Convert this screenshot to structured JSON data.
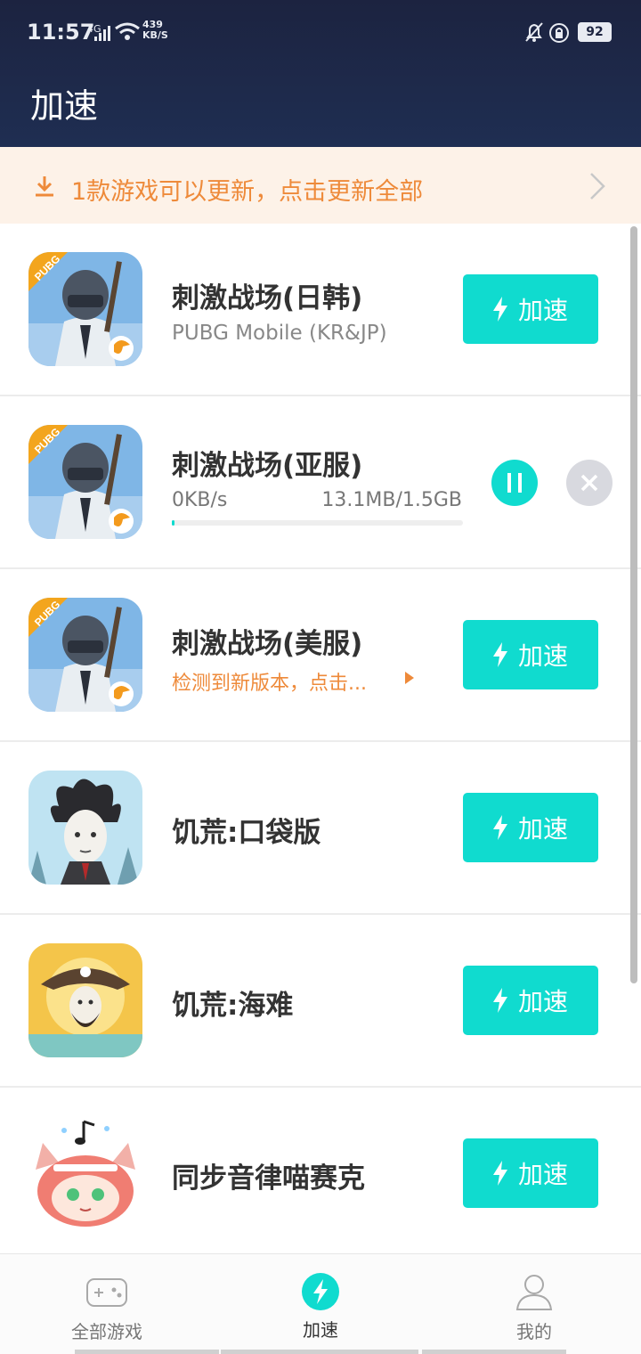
{
  "status_bar": {
    "time": "11:57",
    "network": "4G",
    "speed_value": "439",
    "speed_unit": "KB/S",
    "battery": "92"
  },
  "header": {
    "title": "加速"
  },
  "update_banner": {
    "text": "1款游戏可以更新，点击更新全部"
  },
  "games": [
    {
      "title": "刺激战场(日韩)",
      "subtitle": "PUBG Mobile (KR&JP)",
      "action_label": "加速",
      "icon": "pubg-icon"
    },
    {
      "title": "刺激战场(亚服)",
      "download_speed": "0KB/s",
      "download_size": "13.1MB/1.5GB",
      "progress": 0.0087,
      "icon": "pubg-icon"
    },
    {
      "title": "刺激战场(美服)",
      "update_hint": "检测到新版本，点击...",
      "action_label": "加速",
      "icon": "pubg-icon"
    },
    {
      "title": "饥荒:口袋版",
      "action_label": "加速",
      "icon": "dont-starve-icon"
    },
    {
      "title": "饥荒:海难",
      "action_label": "加速",
      "icon": "dont-starve-shipwrecked-icon"
    },
    {
      "title": "同步音律喵赛克",
      "action_label": "加速",
      "icon": "muse-dash-cat-icon"
    }
  ],
  "bottom_nav": [
    {
      "label": "全部游戏",
      "icon": "gamepad-icon"
    },
    {
      "label": "加速",
      "icon": "bolt-circle-icon",
      "active": true
    },
    {
      "label": "我的",
      "icon": "user-icon"
    }
  ],
  "colors": {
    "accent": "#10dbcf",
    "header_bg": "#1c2340",
    "banner_bg": "#fdf2e8",
    "banner_text": "#ee8a3a",
    "cancel_bg": "#d8d9df"
  }
}
